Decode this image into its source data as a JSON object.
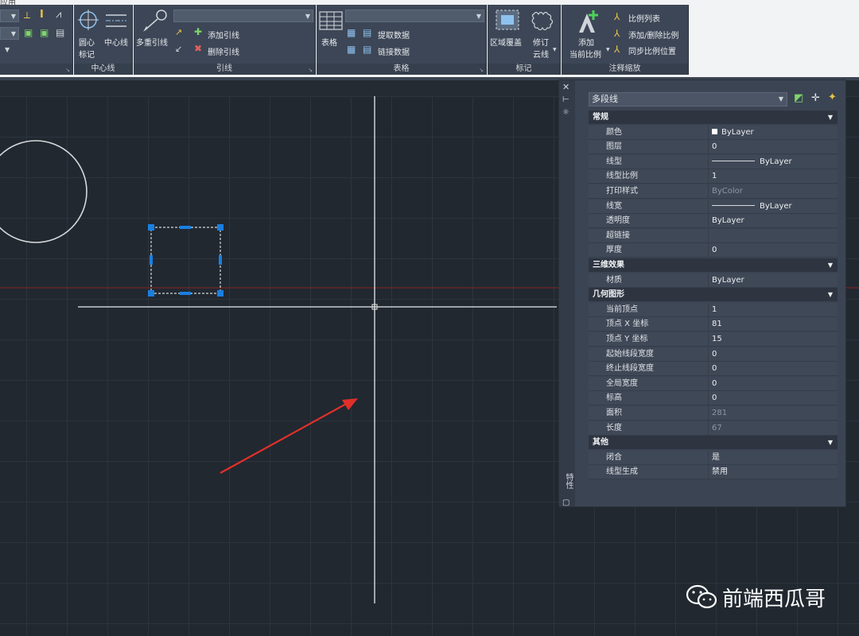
{
  "ribbon": {
    "partial_tab": "应用",
    "centerline_panel": {
      "title": "中心线",
      "center_mark": "圆心",
      "center_mark_sub": "标记",
      "centerline": "中心线"
    },
    "leaders_panel": {
      "title": "引线",
      "multileader": "多重引线",
      "add_leader": "添加引线",
      "remove_leader": "删除引线"
    },
    "tables_panel": {
      "title": "表格",
      "table": "表格",
      "extract_data": "提取数据",
      "link_data": "链接数据"
    },
    "markup_panel": {
      "title": "标记",
      "wipeout": "区域覆盖",
      "revcloud": "修订",
      "revcloud_sub": "云线"
    },
    "scale_panel": {
      "title": "注释缩放",
      "add_current_scale": "添加",
      "add_current_scale_sub": "当前比例",
      "scale_list": "比例列表",
      "add_delete_scales": "添加/删除比例",
      "sync_scale_positions": "同步比例位置"
    }
  },
  "properties": {
    "selection": "多段线",
    "sections": [
      {
        "title": "常规",
        "rows": [
          {
            "label": "颜色",
            "value": "ByLayer",
            "kind": "swatch"
          },
          {
            "label": "图层",
            "value": "0"
          },
          {
            "label": "线型",
            "value": "ByLayer",
            "kind": "line"
          },
          {
            "label": "线型比例",
            "value": "1"
          },
          {
            "label": "打印样式",
            "value": "ByColor",
            "disabled": true
          },
          {
            "label": "线宽",
            "value": "ByLayer",
            "kind": "line"
          },
          {
            "label": "透明度",
            "value": "ByLayer"
          },
          {
            "label": "超链接",
            "value": ""
          },
          {
            "label": "厚度",
            "value": "0"
          }
        ]
      },
      {
        "title": "三维效果",
        "rows": [
          {
            "label": "材质",
            "value": "ByLayer"
          }
        ]
      },
      {
        "title": "几何图形",
        "rows": [
          {
            "label": "当前顶点",
            "value": "1"
          },
          {
            "label": "顶点 X 坐标",
            "value": "81"
          },
          {
            "label": "顶点 Y 坐标",
            "value": "15"
          },
          {
            "label": "起始线段宽度",
            "value": "0"
          },
          {
            "label": "终止线段宽度",
            "value": "0"
          },
          {
            "label": "全局宽度",
            "value": "0"
          },
          {
            "label": "标高",
            "value": "0"
          },
          {
            "label": "面积",
            "value": "281",
            "disabled": true
          },
          {
            "label": "长度",
            "value": "67",
            "disabled": true
          }
        ]
      },
      {
        "title": "其他",
        "rows": [
          {
            "label": "闭合",
            "value": "是"
          },
          {
            "label": "线型生成",
            "value": "禁用"
          }
        ]
      }
    ],
    "side_title": "特性"
  },
  "watermark": "前端西瓜哥",
  "colors": {
    "ribbon_panel": "#3c4656",
    "canvas": "#212830",
    "grip": "#1a7fe0",
    "arrow": "#e0302a",
    "x_axis": "#8a2222"
  }
}
